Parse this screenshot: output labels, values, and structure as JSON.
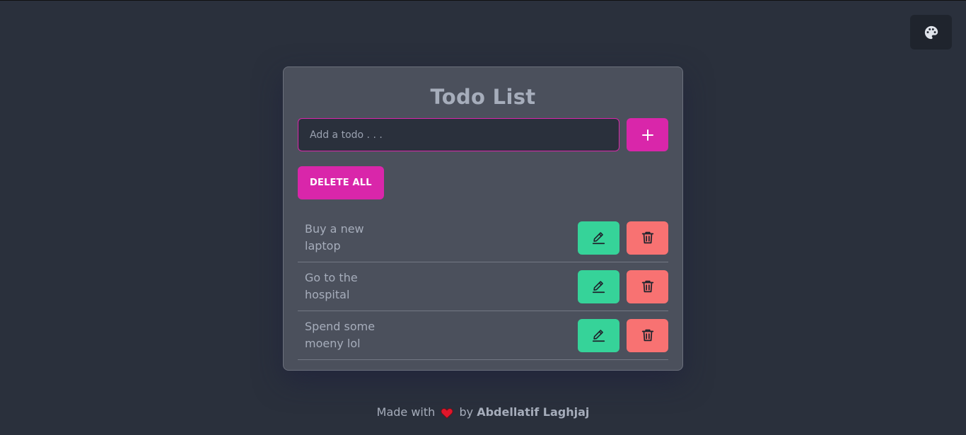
{
  "theme_toggle": {
    "icon": "palette-icon"
  },
  "todo": {
    "title": "Todo List",
    "input_placeholder": "Add a todo . . .",
    "input_value": "",
    "add_icon": "plus-icon",
    "delete_all_label": "DELETE ALL",
    "items": [
      {
        "text": "Buy a new laptop"
      },
      {
        "text": "Go to the hospital"
      },
      {
        "text": "Spend some moeny lol"
      }
    ]
  },
  "footer": {
    "made_with": "Made with",
    "by": "by",
    "author": "Abdellatif Laghjaj"
  },
  "colors": {
    "background": "#2a303c",
    "card": "#4b505c",
    "primary": "#d926aa",
    "edit": "#36d399",
    "delete": "#f87272",
    "text": "#a6adbb"
  }
}
